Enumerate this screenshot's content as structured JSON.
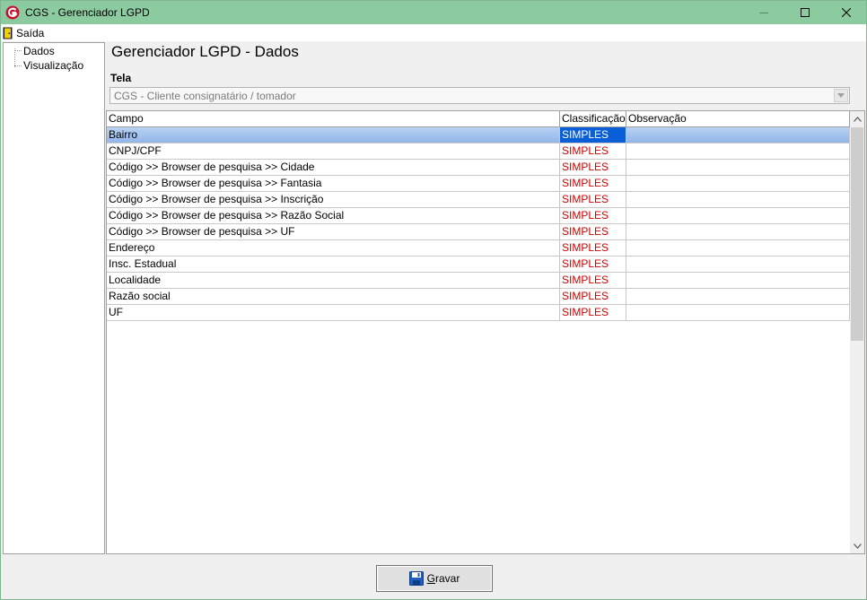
{
  "window": {
    "title": "CGS - Gerenciador LGPD"
  },
  "menu": {
    "items": [
      {
        "label": "Saída",
        "icon": "exit-door-icon"
      }
    ]
  },
  "tree": {
    "items": [
      {
        "label": "Dados"
      },
      {
        "label": "Visualização"
      }
    ]
  },
  "main": {
    "title": "Gerenciador LGPD - Dados",
    "tela_label": "Tela",
    "tela_value": "CGS - Cliente consignatário / tomador"
  },
  "grid": {
    "columns": [
      "Campo",
      "Classificação",
      "Observação"
    ],
    "rows": [
      {
        "campo": "Bairro",
        "classificacao": "SIMPLES",
        "observacao": "",
        "selected": true
      },
      {
        "campo": "CNPJ/CPF",
        "classificacao": "SIMPLES",
        "observacao": ""
      },
      {
        "campo": "Código >> Browser de pesquisa >> Cidade",
        "classificacao": "SIMPLES",
        "observacao": ""
      },
      {
        "campo": "Código >> Browser de pesquisa >> Fantasia",
        "classificacao": "SIMPLES",
        "observacao": ""
      },
      {
        "campo": "Código >> Browser de pesquisa >> Inscrição",
        "classificacao": "SIMPLES",
        "observacao": ""
      },
      {
        "campo": "Código >> Browser de pesquisa >> Razão Social",
        "classificacao": "SIMPLES",
        "observacao": ""
      },
      {
        "campo": "Código >> Browser de pesquisa >> UF",
        "classificacao": "SIMPLES",
        "observacao": ""
      },
      {
        "campo": "Endereço",
        "classificacao": "SIMPLES",
        "observacao": ""
      },
      {
        "campo": "Insc. Estadual",
        "classificacao": "SIMPLES",
        "observacao": ""
      },
      {
        "campo": "Localidade",
        "classificacao": "SIMPLES",
        "observacao": ""
      },
      {
        "campo": "Razão social",
        "classificacao": "SIMPLES",
        "observacao": ""
      },
      {
        "campo": "UF",
        "classificacao": "SIMPLES",
        "observacao": ""
      }
    ]
  },
  "footer": {
    "save_label_mnemonic": "G",
    "save_label_rest": "ravar"
  },
  "colors": {
    "titlebar": "#8ccaa0",
    "classification_text": "#d00000",
    "selection": "#0a5fd8"
  }
}
